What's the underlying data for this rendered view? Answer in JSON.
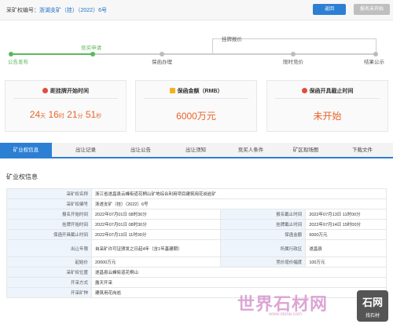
{
  "header": {
    "label": "采矿权编号：",
    "code": "浙湖支矿（挂）（2022）6号",
    "back_button": "返回",
    "signup_button": "报名未开始"
  },
  "timeline": {
    "steps": [
      {
        "top": "",
        "bottom": "公告发布"
      },
      {
        "top": "竞买申请",
        "bottom": ""
      },
      {
        "top": "",
        "bottom": "保函办理"
      },
      {
        "top": "挂牌报价",
        "bottom": ""
      },
      {
        "top": "",
        "bottom": "限时竞价"
      },
      {
        "top": "",
        "bottom": "结果公示"
      }
    ]
  },
  "cards": [
    {
      "icon": "clock-icon",
      "title": "距挂牌开始时间",
      "days": "24",
      "d": "天",
      "hours": "16",
      "h": "时",
      "mins": "21",
      "m": "分",
      "secs": "51",
      "s": "秒"
    },
    {
      "icon": "coin-icon",
      "title": "保函金额（RMB）",
      "value": "6000万元"
    },
    {
      "icon": "alarm-icon",
      "title": "保函开具截止时间",
      "value": "未开始"
    }
  ],
  "tabs": [
    "矿业权信息",
    "出让记录",
    "出让公告",
    "出让须知",
    "竞买人条件",
    "矿区现场图",
    "下载文件"
  ],
  "section_title": "矿业权信息",
  "table": {
    "name_label": "采矿权名称",
    "name_value": "浙江省遂昌县云峰街道花桐山矿地综合利用项目建筑用花岗岩矿",
    "code_label": "采矿权编号",
    "code_value": "浙遂支矿（挂）（2022）6号",
    "rows": [
      [
        "报名开始时间",
        "2022年07月01日 08时30分",
        "报名截止时间",
        "2022年07月13日 11时00分"
      ],
      [
        "挂牌开始时间",
        "2022年07月01日 08时30分",
        "挂牌截止时间",
        "2022年07月14日 15时00分"
      ],
      [
        "保函开具截止时间",
        "2022年07月13日 11时00分",
        "保函金额",
        "6000万元"
      ],
      [
        "出让年限",
        "自采矿许可证颁发之日起4年（含1年基建期）",
        "所属行政区",
        "遂昌县"
      ],
      [
        "起始价",
        "20000万元",
        "竞价增价幅度",
        "100万元"
      ]
    ],
    "location_label": "采矿权位置",
    "location_value": "遂昌县云峰街道花桐山",
    "method_label": "开采方式",
    "method_value": "露天开采",
    "mineral_label": "开采矿种",
    "mineral_value": "建筑用花岗岩"
  },
  "watermark": {
    "text": "世界石材网",
    "url": "www.stone.com",
    "logo_top": "石网",
    "logo_bottom": "找石材"
  },
  "colors": {
    "accent": "#2d7fd3",
    "green": "#5cb85c",
    "orange": "#e8652b"
  }
}
